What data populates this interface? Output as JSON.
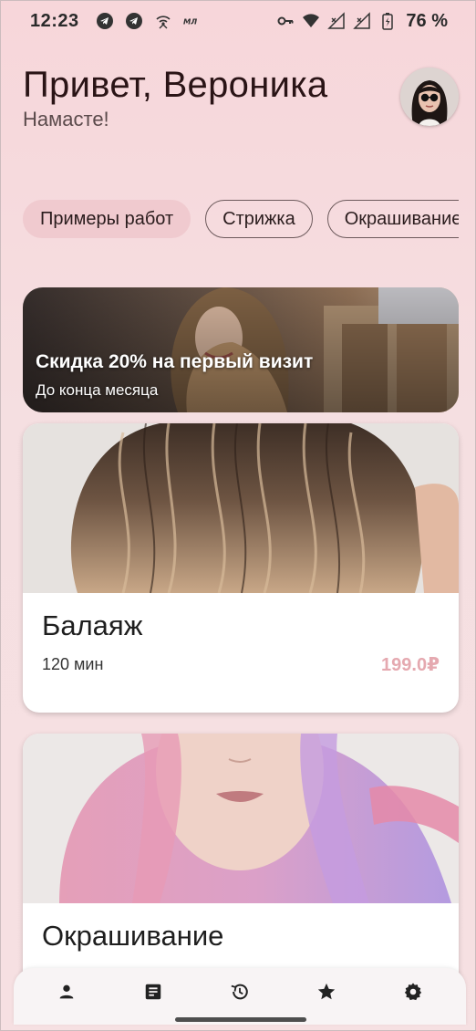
{
  "status_bar": {
    "time": "12:23",
    "battery": "76 %",
    "left_icons": [
      "telegram-icon",
      "telegram-icon",
      "wifi-hotspot-icon",
      "mts-icon"
    ],
    "right_icons": [
      "key-icon",
      "wifi-icon",
      "signal-icon",
      "signal-icon",
      "battery-icon"
    ]
  },
  "header": {
    "greeting": "Привет, Вероника",
    "subtitle": "Намасте!"
  },
  "chips": [
    {
      "label": "Примеры работ",
      "selected": true
    },
    {
      "label": "Стрижка",
      "selected": false
    },
    {
      "label": "Окрашивание",
      "selected": false
    }
  ],
  "promo": {
    "title": "Скидка 20% на первый визит",
    "subtitle": "До конца месяца"
  },
  "services": [
    {
      "title": "Балаяж",
      "duration": "120 мин",
      "price": "199.0₽"
    },
    {
      "title": "Окрашивание"
    }
  ],
  "bottom_nav": [
    "person-icon",
    "document-icon",
    "history-icon",
    "star-icon",
    "settings-icon"
  ],
  "colors": {
    "background": "#f7d6da",
    "chip_selected": "#f0cacf",
    "price": "#e5a9b0",
    "text_dark": "#2a1416"
  }
}
